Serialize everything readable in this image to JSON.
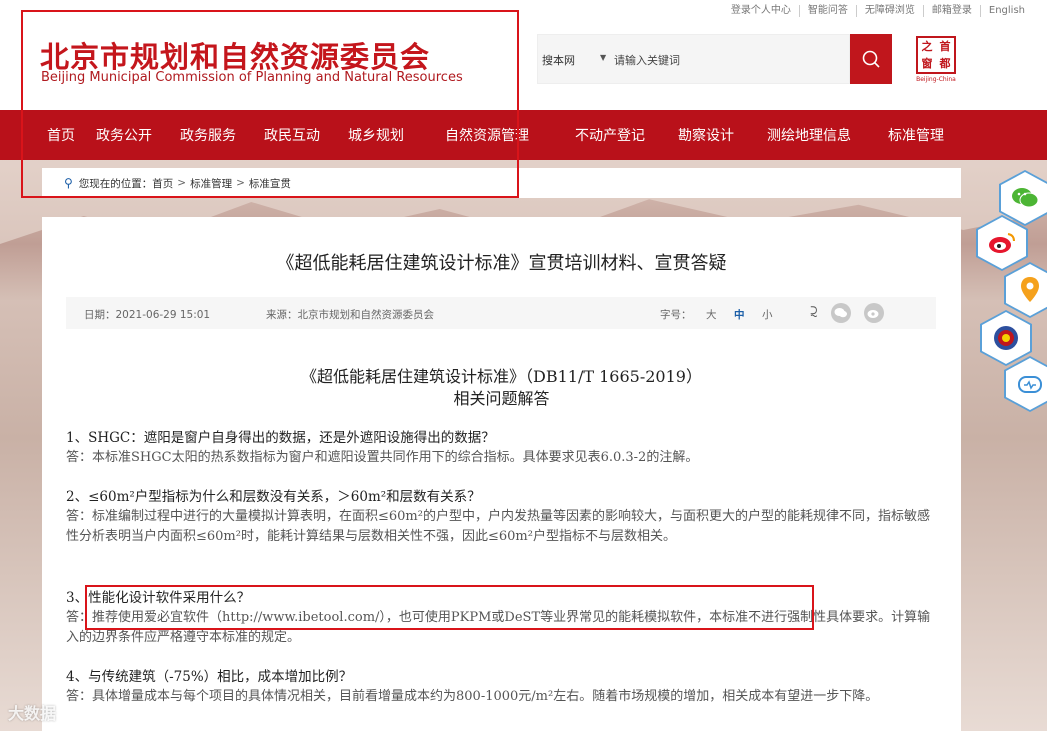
{
  "top_links": [
    "登录个人中心",
    "智能问答",
    "无障碍浏览",
    "邮箱登录",
    "English"
  ],
  "logo": {
    "cn": "北京市规划和自然资源委员会",
    "en": "Beijing Municipal Commission of Planning and Natural Resources"
  },
  "search": {
    "scope": "搜本网",
    "placeholder": "请输入关键词"
  },
  "seal": {
    "chars": [
      "首",
      "之",
      "都",
      "窗"
    ],
    "caption": "Beijing-China"
  },
  "nav": [
    "首页",
    "政务公开",
    "政务服务",
    "政民互动",
    "城乡规划",
    "自然资源管理",
    "不动产登记",
    "勘察设计",
    "测绘地理信息",
    "标准管理"
  ],
  "breadcrumb": {
    "prefix": "您现在的位置：",
    "items": [
      "首页",
      "标准管理",
      "标准宣贯"
    ],
    "sep": ">"
  },
  "article": {
    "title": "《超低能耗居住建筑设计标准》宣贯培训材料、宣贯答疑",
    "date": "日期：2021-06-29 15:01",
    "source": "来源：北京市规划和自然资源委员会",
    "font_label": "字号：",
    "font_sizes": [
      "大",
      "中",
      "小"
    ],
    "doc_title_line1": "《超低能耗居住建筑设计标准》（DB11/T 1665-2019）",
    "doc_title_line2": "相关问题解答",
    "qa": [
      {
        "q": "1、SHGC：遮阳是窗户自身得出的数据，还是外遮阳设施得出的数据？",
        "a": "答：本标准SHGC太阳的热系数指标为窗户和遮阳设置共同作用下的综合指标。具体要求见表6.0.3-2的注解。"
      },
      {
        "q": "2、≤60m²户型指标为什么和层数没有关系，＞60m²和层数有关系？",
        "a": "答：标准编制过程中进行的大量模拟计算表明，在面积≤60m²的户型中，户内发热量等因素的影响较大，与面积更大的户型的能耗规律不同，指标敏感性分析表明当户内面积≤60m²时，能耗计算结果与层数相关性不强，因此≤60m²户型指标不与层数相关。"
      },
      {
        "q": "3、性能化设计软件采用什么？",
        "a": "答：推荐使用爱必宜软件（http://www.ibetool.com/），也可使用PKPM或DeST等业界常见的能耗模拟软件，本标准不进行强制性具体要求。计算输入的边界条件应严格遵守本标准的规定。"
      },
      {
        "q": "4、与传统建筑（-75%）相比，成本增加比例？",
        "a": "答：具体增量成本与每个项目的具体情况相关，目前看增量成本约为800-1000元/m²左右。随着市场规模的增加，相关成本有望进一步下降。"
      }
    ]
  },
  "watermark": "大数据"
}
